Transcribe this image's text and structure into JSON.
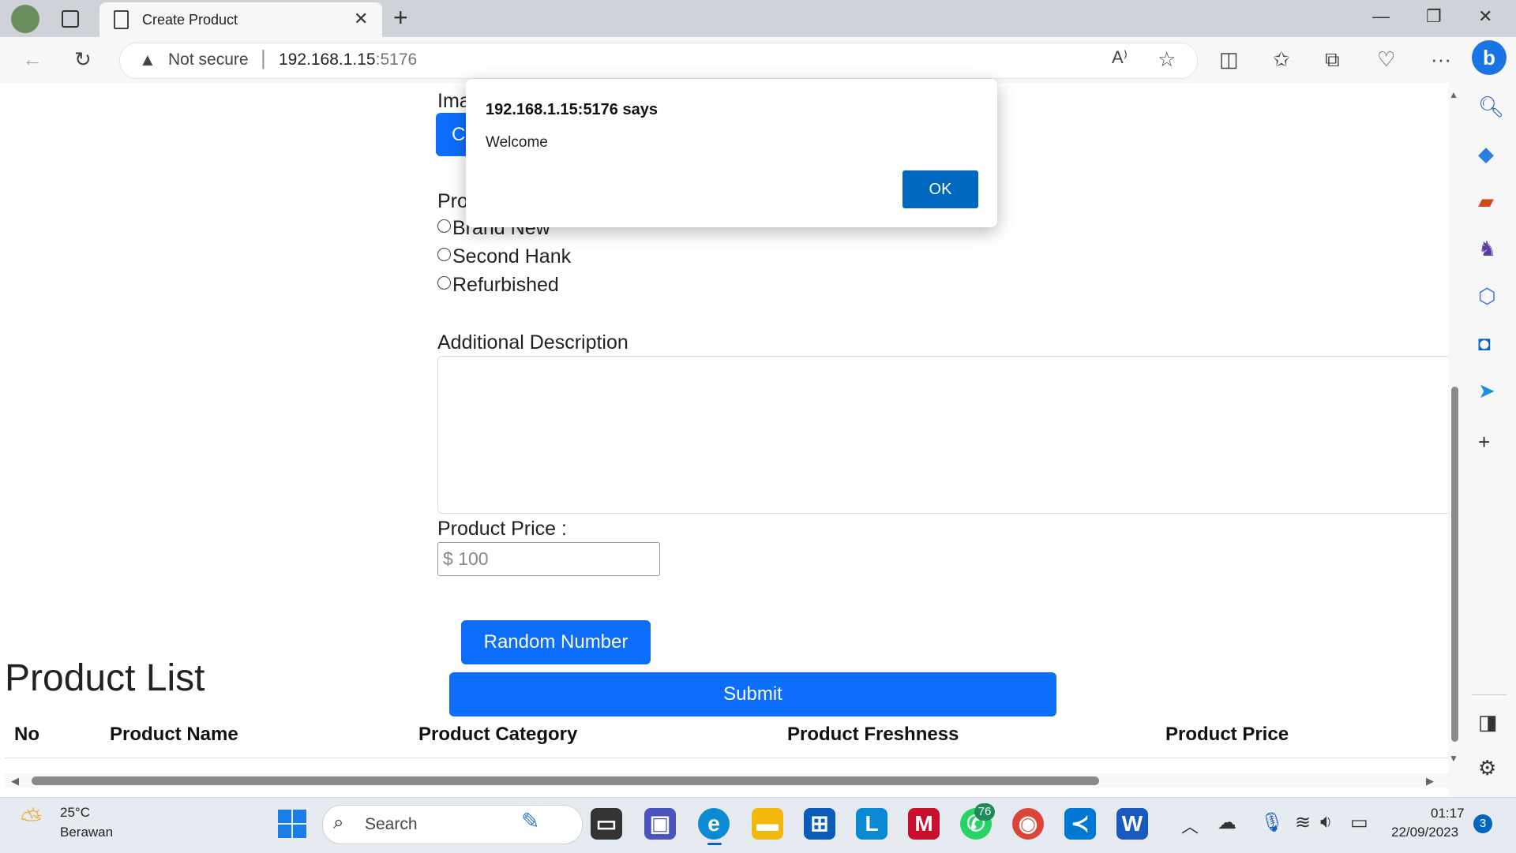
{
  "browser": {
    "tab_title": "Create Product",
    "new_tab_label": "+",
    "not_secure": "Not secure",
    "url_host": "192.168.1.15",
    "url_port": ":5176"
  },
  "form": {
    "image_label_partial": "Ima",
    "choose_button_partial": "Cl",
    "freshness_label_partial": "Pro",
    "freshness_options": [
      "Brand New",
      "Second Hank",
      "Refurbished"
    ],
    "additional_description_label": "Additional Description",
    "price_label": "Product Price :",
    "price_placeholder": "$ 100",
    "random_button": "Random Number",
    "submit_button": "Submit"
  },
  "product_list": {
    "title": "Product List",
    "columns": [
      "No",
      "Product Name",
      "Product Category",
      "Product Freshness",
      "Product Price"
    ]
  },
  "dialog": {
    "title": "192.168.1.15:5176 says",
    "message": "Welcome",
    "ok_label": "OK"
  },
  "taskbar": {
    "weather_temp": "25°C",
    "weather_desc": "Berawan",
    "search_placeholder": "Search",
    "whatsapp_badge": "76",
    "time": "01:17",
    "date": "22/09/2023",
    "notification_count": "3"
  },
  "colors": {
    "primary": "#0d6efd",
    "dialog_ok": "#0067c0"
  }
}
